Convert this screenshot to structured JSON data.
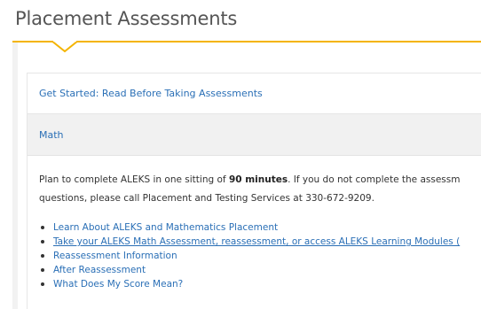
{
  "header": {
    "title": "Placement Assessments"
  },
  "accordion": {
    "get_started_label": "Get Started: Read Before Taking Assessments",
    "math_label": "Math"
  },
  "math_section": {
    "intro_line1_prefix": "Plan to complete ALEKS in one sitting of ",
    "intro_line1_bold": "90 minutes",
    "intro_line1_suffix": ". If you do not complete the assessm",
    "intro_line2": "questions, please call Placement and Testing Services at 330-672-9209.",
    "links": [
      "Learn About ALEKS and Mathematics Placement",
      "Take your ALEKS Math Assessment, reassessment, or access ALEKS Learning Modules (",
      "Reassessment Information",
      "After Reassessment",
      "What Does My Score Mean?"
    ]
  },
  "colors": {
    "accent": "#f4b400",
    "link": "#2a6fb6",
    "panel_header_bg": "#f1f1f1"
  }
}
